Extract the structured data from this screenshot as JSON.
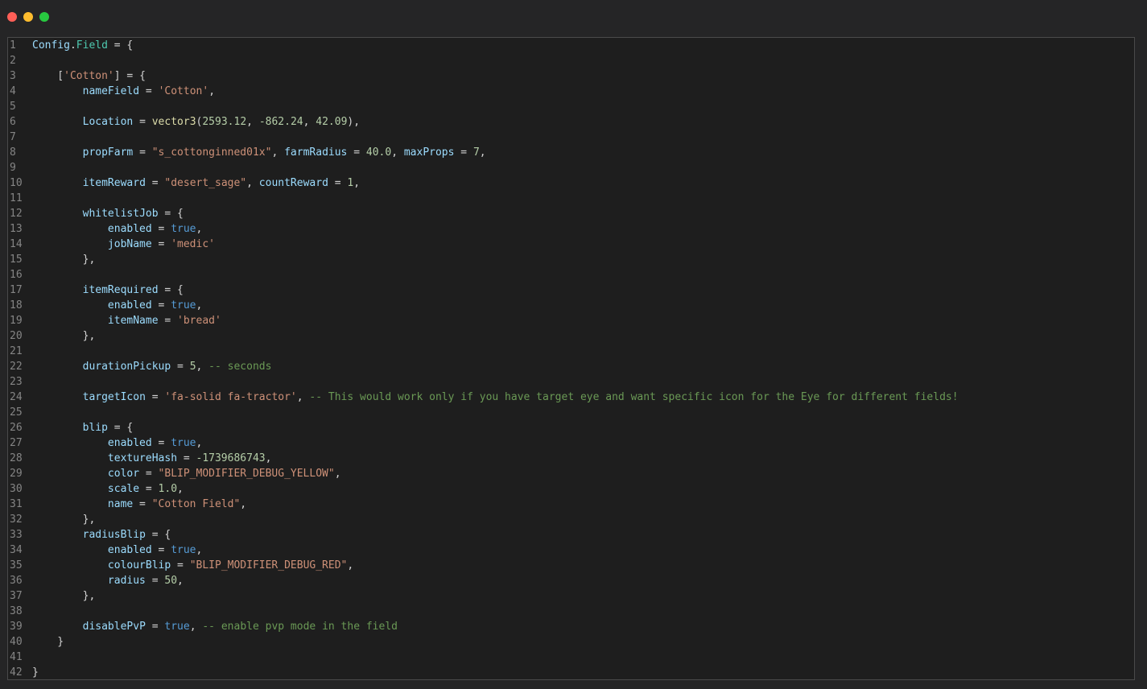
{
  "window": {
    "traffic_lights": [
      {
        "name": "close",
        "color": "#ff5f57"
      },
      {
        "name": "minimize",
        "color": "#febc2e"
      },
      {
        "name": "maximize",
        "color": "#28c840"
      }
    ]
  },
  "editor": {
    "lines": [
      {
        "n": "1",
        "tokens": [
          {
            "t": "Config",
            "c": "key"
          },
          {
            "t": ".",
            "c": "plain"
          },
          {
            "t": "Field",
            "c": "prop"
          },
          {
            "t": " = {",
            "c": "plain"
          }
        ]
      },
      {
        "n": "2",
        "tokens": []
      },
      {
        "n": "3",
        "tokens": [
          {
            "t": "    [",
            "c": "plain"
          },
          {
            "t": "'Cotton'",
            "c": "str"
          },
          {
            "t": "] = {",
            "c": "plain"
          }
        ]
      },
      {
        "n": "4",
        "tokens": [
          {
            "t": "        ",
            "c": "plain"
          },
          {
            "t": "nameField",
            "c": "key"
          },
          {
            "t": " = ",
            "c": "plain"
          },
          {
            "t": "'Cotton'",
            "c": "str"
          },
          {
            "t": ",",
            "c": "plain"
          }
        ]
      },
      {
        "n": "5",
        "tokens": []
      },
      {
        "n": "6",
        "tokens": [
          {
            "t": "        ",
            "c": "plain"
          },
          {
            "t": "Location",
            "c": "key"
          },
          {
            "t": " = ",
            "c": "plain"
          },
          {
            "t": "vector3",
            "c": "func"
          },
          {
            "t": "(",
            "c": "plain"
          },
          {
            "t": "2593.12",
            "c": "num"
          },
          {
            "t": ", ",
            "c": "plain"
          },
          {
            "t": "-862.24",
            "c": "num"
          },
          {
            "t": ", ",
            "c": "plain"
          },
          {
            "t": "42.09",
            "c": "num"
          },
          {
            "t": "),",
            "c": "plain"
          }
        ]
      },
      {
        "n": "7",
        "tokens": []
      },
      {
        "n": "8",
        "tokens": [
          {
            "t": "        ",
            "c": "plain"
          },
          {
            "t": "propFarm",
            "c": "key"
          },
          {
            "t": " = ",
            "c": "plain"
          },
          {
            "t": "\"s_cottonginned01x\"",
            "c": "str"
          },
          {
            "t": ", ",
            "c": "plain"
          },
          {
            "t": "farmRadius",
            "c": "key"
          },
          {
            "t": " = ",
            "c": "plain"
          },
          {
            "t": "40.0",
            "c": "num"
          },
          {
            "t": ", ",
            "c": "plain"
          },
          {
            "t": "maxProps",
            "c": "key"
          },
          {
            "t": " = ",
            "c": "plain"
          },
          {
            "t": "7",
            "c": "num"
          },
          {
            "t": ",",
            "c": "plain"
          }
        ]
      },
      {
        "n": "9",
        "tokens": []
      },
      {
        "n": "10",
        "tokens": [
          {
            "t": "        ",
            "c": "plain"
          },
          {
            "t": "itemReward",
            "c": "key"
          },
          {
            "t": " = ",
            "c": "plain"
          },
          {
            "t": "\"desert_sage\"",
            "c": "str"
          },
          {
            "t": ", ",
            "c": "plain"
          },
          {
            "t": "countReward",
            "c": "key"
          },
          {
            "t": " = ",
            "c": "plain"
          },
          {
            "t": "1",
            "c": "num"
          },
          {
            "t": ",",
            "c": "plain"
          }
        ]
      },
      {
        "n": "11",
        "tokens": []
      },
      {
        "n": "12",
        "tokens": [
          {
            "t": "        ",
            "c": "plain"
          },
          {
            "t": "whitelistJob",
            "c": "key"
          },
          {
            "t": " = {",
            "c": "plain"
          }
        ]
      },
      {
        "n": "13",
        "tokens": [
          {
            "t": "            ",
            "c": "plain"
          },
          {
            "t": "enabled",
            "c": "key"
          },
          {
            "t": " = ",
            "c": "plain"
          },
          {
            "t": "true",
            "c": "bool"
          },
          {
            "t": ",",
            "c": "plain"
          }
        ]
      },
      {
        "n": "14",
        "tokens": [
          {
            "t": "            ",
            "c": "plain"
          },
          {
            "t": "jobName",
            "c": "key"
          },
          {
            "t": " = ",
            "c": "plain"
          },
          {
            "t": "'medic'",
            "c": "str"
          }
        ]
      },
      {
        "n": "15",
        "tokens": [
          {
            "t": "        },",
            "c": "plain"
          }
        ]
      },
      {
        "n": "16",
        "tokens": []
      },
      {
        "n": "17",
        "tokens": [
          {
            "t": "        ",
            "c": "plain"
          },
          {
            "t": "itemRequired",
            "c": "key"
          },
          {
            "t": " = {",
            "c": "plain"
          }
        ]
      },
      {
        "n": "18",
        "tokens": [
          {
            "t": "            ",
            "c": "plain"
          },
          {
            "t": "enabled",
            "c": "key"
          },
          {
            "t": " = ",
            "c": "plain"
          },
          {
            "t": "true",
            "c": "bool"
          },
          {
            "t": ",",
            "c": "plain"
          }
        ]
      },
      {
        "n": "19",
        "tokens": [
          {
            "t": "            ",
            "c": "plain"
          },
          {
            "t": "itemName",
            "c": "key"
          },
          {
            "t": " = ",
            "c": "plain"
          },
          {
            "t": "'bread'",
            "c": "str"
          }
        ]
      },
      {
        "n": "20",
        "tokens": [
          {
            "t": "        },",
            "c": "plain"
          }
        ]
      },
      {
        "n": "21",
        "tokens": []
      },
      {
        "n": "22",
        "tokens": [
          {
            "t": "        ",
            "c": "plain"
          },
          {
            "t": "durationPickup",
            "c": "key"
          },
          {
            "t": " = ",
            "c": "plain"
          },
          {
            "t": "5",
            "c": "num"
          },
          {
            "t": ", ",
            "c": "plain"
          },
          {
            "t": "-- seconds",
            "c": "comment"
          }
        ]
      },
      {
        "n": "23",
        "tokens": []
      },
      {
        "n": "24",
        "tokens": [
          {
            "t": "        ",
            "c": "plain"
          },
          {
            "t": "targetIcon",
            "c": "key"
          },
          {
            "t": " = ",
            "c": "plain"
          },
          {
            "t": "'fa-solid fa-tractor'",
            "c": "str"
          },
          {
            "t": ", ",
            "c": "plain"
          },
          {
            "t": "-- This would work only if you have target eye and want specific icon for the Eye for different fields!",
            "c": "comment"
          }
        ]
      },
      {
        "n": "25",
        "tokens": []
      },
      {
        "n": "26",
        "tokens": [
          {
            "t": "        ",
            "c": "plain"
          },
          {
            "t": "blip",
            "c": "key"
          },
          {
            "t": " = {",
            "c": "plain"
          }
        ]
      },
      {
        "n": "27",
        "tokens": [
          {
            "t": "            ",
            "c": "plain"
          },
          {
            "t": "enabled",
            "c": "key"
          },
          {
            "t": " = ",
            "c": "plain"
          },
          {
            "t": "true",
            "c": "bool"
          },
          {
            "t": ",",
            "c": "plain"
          }
        ]
      },
      {
        "n": "28",
        "tokens": [
          {
            "t": "            ",
            "c": "plain"
          },
          {
            "t": "textureHash",
            "c": "key"
          },
          {
            "t": " = ",
            "c": "plain"
          },
          {
            "t": "-1739686743",
            "c": "num"
          },
          {
            "t": ",",
            "c": "plain"
          }
        ]
      },
      {
        "n": "29",
        "tokens": [
          {
            "t": "            ",
            "c": "plain"
          },
          {
            "t": "color",
            "c": "key"
          },
          {
            "t": " = ",
            "c": "plain"
          },
          {
            "t": "\"BLIP_MODIFIER_DEBUG_YELLOW\"",
            "c": "str"
          },
          {
            "t": ",",
            "c": "plain"
          }
        ]
      },
      {
        "n": "30",
        "tokens": [
          {
            "t": "            ",
            "c": "plain"
          },
          {
            "t": "scale",
            "c": "key"
          },
          {
            "t": " = ",
            "c": "plain"
          },
          {
            "t": "1.0",
            "c": "num"
          },
          {
            "t": ",",
            "c": "plain"
          }
        ]
      },
      {
        "n": "31",
        "tokens": [
          {
            "t": "            ",
            "c": "plain"
          },
          {
            "t": "name",
            "c": "key"
          },
          {
            "t": " = ",
            "c": "plain"
          },
          {
            "t": "\"Cotton Field\"",
            "c": "str"
          },
          {
            "t": ",",
            "c": "plain"
          }
        ]
      },
      {
        "n": "32",
        "tokens": [
          {
            "t": "        },",
            "c": "plain"
          }
        ]
      },
      {
        "n": "33",
        "tokens": [
          {
            "t": "        ",
            "c": "plain"
          },
          {
            "t": "radiusBlip",
            "c": "key"
          },
          {
            "t": " = {",
            "c": "plain"
          }
        ]
      },
      {
        "n": "34",
        "tokens": [
          {
            "t": "            ",
            "c": "plain"
          },
          {
            "t": "enabled",
            "c": "key"
          },
          {
            "t": " = ",
            "c": "plain"
          },
          {
            "t": "true",
            "c": "bool"
          },
          {
            "t": ",",
            "c": "plain"
          }
        ]
      },
      {
        "n": "35",
        "tokens": [
          {
            "t": "            ",
            "c": "plain"
          },
          {
            "t": "colourBlip",
            "c": "key"
          },
          {
            "t": " = ",
            "c": "plain"
          },
          {
            "t": "\"BLIP_MODIFIER_DEBUG_RED\"",
            "c": "str"
          },
          {
            "t": ",",
            "c": "plain"
          }
        ]
      },
      {
        "n": "36",
        "tokens": [
          {
            "t": "            ",
            "c": "plain"
          },
          {
            "t": "radius",
            "c": "key"
          },
          {
            "t": " = ",
            "c": "plain"
          },
          {
            "t": "50",
            "c": "num"
          },
          {
            "t": ",",
            "c": "plain"
          }
        ]
      },
      {
        "n": "37",
        "tokens": [
          {
            "t": "        },",
            "c": "plain"
          }
        ]
      },
      {
        "n": "38",
        "tokens": []
      },
      {
        "n": "39",
        "tokens": [
          {
            "t": "        ",
            "c": "plain"
          },
          {
            "t": "disablePvP",
            "c": "key"
          },
          {
            "t": " = ",
            "c": "plain"
          },
          {
            "t": "true",
            "c": "bool"
          },
          {
            "t": ", ",
            "c": "plain"
          },
          {
            "t": "-- enable pvp mode in the field",
            "c": "comment"
          }
        ]
      },
      {
        "n": "40",
        "tokens": [
          {
            "t": "    }",
            "c": "plain"
          }
        ]
      },
      {
        "n": "41",
        "tokens": []
      },
      {
        "n": "42",
        "tokens": [
          {
            "t": "}",
            "c": "plain"
          }
        ]
      }
    ]
  }
}
